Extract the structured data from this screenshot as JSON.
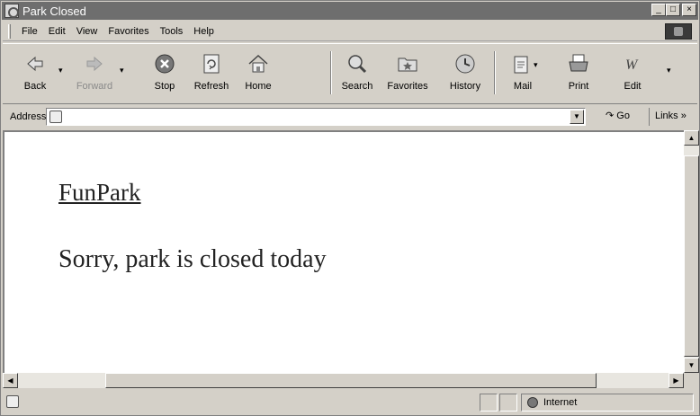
{
  "window": {
    "title": "Park Closed"
  },
  "title_buttons": {
    "minimize": "_",
    "maximize": "□",
    "close": "×"
  },
  "menu": [
    "File",
    "Edit",
    "View",
    "Favorites",
    "Tools",
    "Help"
  ],
  "toolbar": {
    "back": "Back",
    "forward": "Forward",
    "stop": "Stop",
    "refresh": "Refresh",
    "home": "Home",
    "search": "Search",
    "favorites": "Favorites",
    "history": "History",
    "mail": "Mail",
    "print": "Print",
    "edit": "Edit"
  },
  "address": {
    "label": "Address",
    "value": "",
    "go": "Go",
    "links": "Links »"
  },
  "content": {
    "site_title": "FunPark",
    "message": "Sorry, park is closed today"
  },
  "status": {
    "zone": "Internet"
  }
}
